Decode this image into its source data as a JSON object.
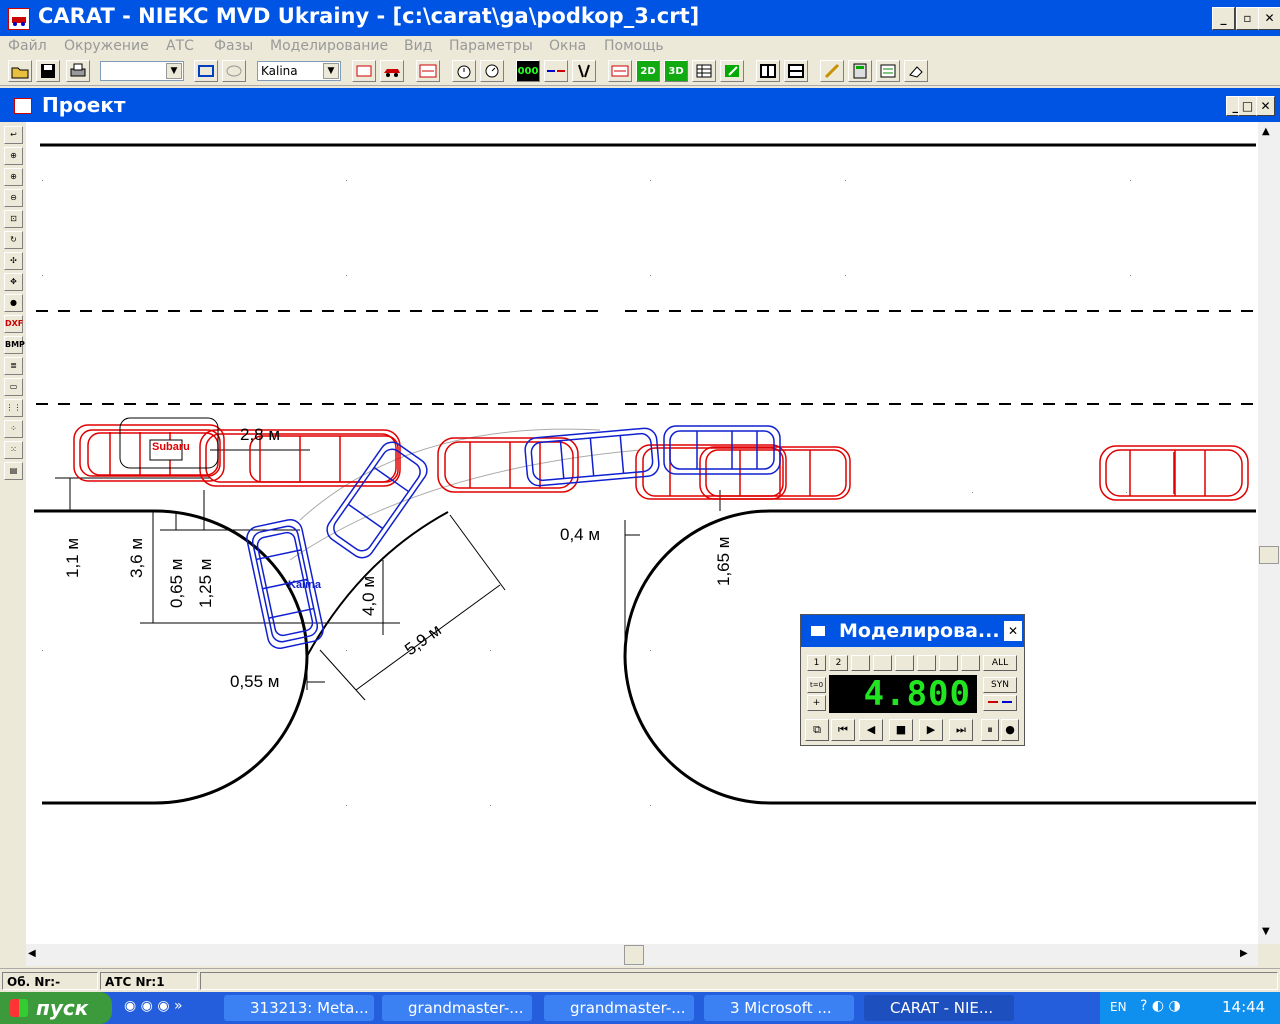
{
  "window": {
    "title": "CARAT - NIEKC MVD Ukrainy - [c:\\carat\\ga\\podkop_3.crt]",
    "minimize_label": "_",
    "restore_label": "▫",
    "close_label": "✕"
  },
  "menu": {
    "items": [
      "Файл",
      "Окружение",
      "АТС",
      "Фазы",
      "Моделирование",
      "Вид",
      "Параметры",
      "Окна",
      "Помощь"
    ]
  },
  "toolbar": {
    "combo1_value": "",
    "vehicle_combo_value": "Kalina",
    "view_2d_label": "2D",
    "view_3d_label": "3D",
    "counter_label": "000"
  },
  "child_window": {
    "title": "Проект",
    "minimize_label": "_",
    "restore_label": "□",
    "close_label": "✕"
  },
  "left_tools": {
    "dxf_label": "DXF",
    "bmp_label": "BMP"
  },
  "canvas": {
    "vehicle_labels": {
      "red_car": "Subaru",
      "blue_car": "Kalina"
    },
    "dimension_labels": [
      "2,8 м",
      "1,1 м",
      "3,6 м",
      "0,65 м",
      "1,25 м",
      "4,0 м",
      "5,9 м",
      "0,55 м",
      "0,4 м",
      "1,65 м"
    ]
  },
  "simulation_panel": {
    "title": "Моделирова...",
    "close_label": "✕",
    "phase_buttons": [
      "1",
      "2",
      "",
      "",
      "",
      "",
      "",
      ""
    ],
    "all_label": "ALL",
    "t0_label": "t=0",
    "syn_label": "SYN",
    "time_value": "4.800"
  },
  "status_bar": {
    "field1": "Об. Nr:-",
    "field2": "АТС Nr:1"
  },
  "taskbar": {
    "start_label": "пуск",
    "tasks": [
      "313213: Meta...",
      "grandmaster-...",
      "grandmaster-...",
      "3 Microsoft ...",
      "CARAT - NIE..."
    ],
    "lang": "EN",
    "clock": "14:44"
  },
  "colors": {
    "xp_blue": "#0054E3",
    "red_vehicle": "#E00000",
    "blue_vehicle": "#1020D0",
    "lcd_green": "#22E522"
  }
}
